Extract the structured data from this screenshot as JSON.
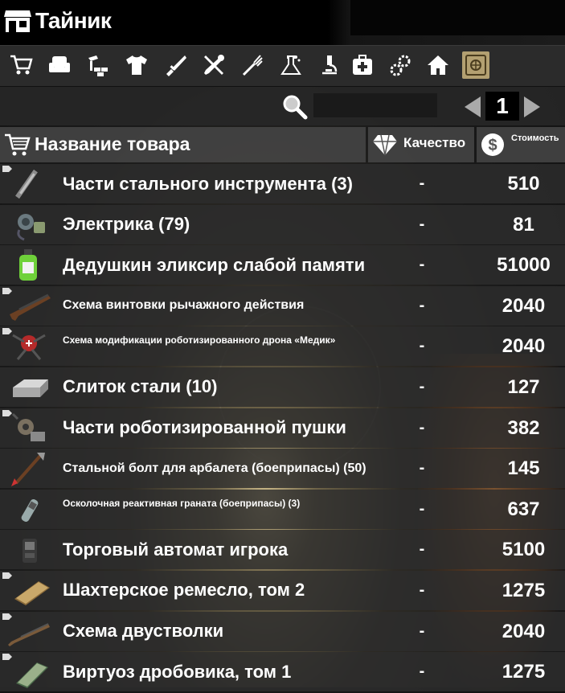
{
  "window": {
    "title": "Тайник"
  },
  "categories": [
    {
      "icon": "cart-icon",
      "label": ""
    },
    {
      "icon": "armchair-icon",
      "label": ""
    },
    {
      "icon": "building-blocks-icon",
      "label": ""
    },
    {
      "icon": "shirt-icon",
      "label": ""
    },
    {
      "icon": "knife-icon",
      "label": ""
    },
    {
      "icon": "tools-icon",
      "label": ""
    },
    {
      "icon": "fork-icon",
      "label": ""
    },
    {
      "icon": "flask-icon",
      "label": ""
    },
    {
      "icon": "microscope-icon",
      "label": ""
    },
    {
      "icon": "medkit-icon",
      "label": ""
    },
    {
      "icon": "gears-icon",
      "label": ""
    },
    {
      "icon": "house-icon",
      "label": ""
    },
    {
      "icon": "safe-icon",
      "label": "",
      "active": true
    }
  ],
  "search": {
    "value": "",
    "placeholder": ""
  },
  "pager": {
    "page": "1"
  },
  "table": {
    "headers": {
      "name": "Название товара",
      "quality": "Качество",
      "price": "Стоимость"
    },
    "rows": [
      {
        "name": "Части стального инструмента (3)",
        "quality": "-",
        "price": "510",
        "icon": "steel-tool-parts-icon",
        "tag": true,
        "size": "big"
      },
      {
        "name": "Электрика (79)",
        "quality": "-",
        "price": "81",
        "icon": "electrical-parts-icon",
        "tag": false,
        "size": "big"
      },
      {
        "name": "Дедушкин эликсир слабой памяти",
        "quality": "-",
        "price": "51000",
        "icon": "elixir-bottle-icon",
        "tag": false,
        "size": "big"
      },
      {
        "name": "Схема винтовки рычажного действия",
        "quality": "-",
        "price": "2040",
        "icon": "lever-rifle-icon",
        "tag": true,
        "size": "mid"
      },
      {
        "name": "Схема модификации роботизированного дрона «Медик»",
        "quality": "-",
        "price": "2040",
        "icon": "drone-mod-icon",
        "tag": true,
        "size": "small"
      },
      {
        "name": "Слиток стали (10)",
        "quality": "-",
        "price": "127",
        "icon": "steel-ingot-icon",
        "tag": false,
        "size": "big"
      },
      {
        "name": "Части роботизированной пушки",
        "quality": "-",
        "price": "382",
        "icon": "turret-parts-icon",
        "tag": true,
        "size": "big"
      },
      {
        "name": "Стальной болт для арбалета (боеприпасы) (50)",
        "quality": "-",
        "price": "145",
        "icon": "crossbow-bolt-icon",
        "tag": false,
        "size": "mid"
      },
      {
        "name": "Осколочная реактивная граната (боеприпасы) (3)",
        "quality": "-",
        "price": "637",
        "icon": "rocket-grenade-icon",
        "tag": false,
        "size": "small"
      },
      {
        "name": "Торговый автомат игрока",
        "quality": "-",
        "price": "5100",
        "icon": "vending-machine-icon",
        "tag": false,
        "size": "big"
      },
      {
        "name": "Шахтерское ремесло, том 2",
        "quality": "-",
        "price": "1275",
        "icon": "mining-book-icon",
        "tag": true,
        "size": "big"
      },
      {
        "name": "Схема двустволки",
        "quality": "-",
        "price": "2040",
        "icon": "double-barrel-icon",
        "tag": true,
        "size": "big"
      },
      {
        "name": "Виртуоз дробовика, том 1",
        "quality": "-",
        "price": "1275",
        "icon": "shotgun-book-icon",
        "tag": true,
        "size": "big"
      }
    ]
  },
  "colors": {
    "active_tab": "#b3a071",
    "row_bg": "#2d2d2d",
    "header_bg": "#464646"
  }
}
